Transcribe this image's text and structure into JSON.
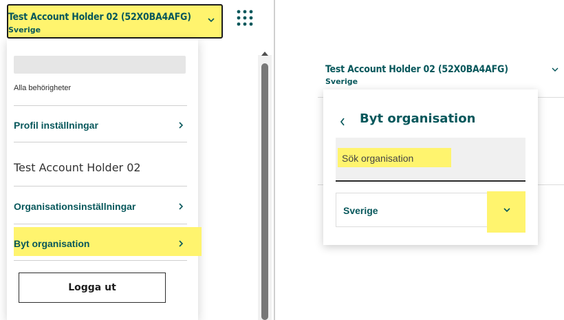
{
  "left": {
    "account": {
      "name": "Test Account Holder 02 (52X0BA4AFG)",
      "country": "Sverige"
    },
    "menu": {
      "permissions": "Alla behörigheter",
      "profile_settings": "Profil inställningar",
      "organisation_name": "Test Account Holder 02",
      "org_settings": "Organisationsinställningar",
      "switch_org": "Byt organisation",
      "logout": "Logga ut"
    }
  },
  "right": {
    "account": {
      "name": "Test Account Holder 02 (52X0BA4AFG)",
      "country": "Sverige"
    },
    "panel": {
      "title": "Byt organisation",
      "search_placeholder": "Sök organisation",
      "country_select": "Sverige"
    }
  },
  "colors": {
    "brand_teal": "#07575b",
    "highlight_yellow": "#fff46e"
  },
  "icons": [
    "chevron-down-icon",
    "apps-grid-icon",
    "chevron-right-icon",
    "chevron-left-icon"
  ]
}
